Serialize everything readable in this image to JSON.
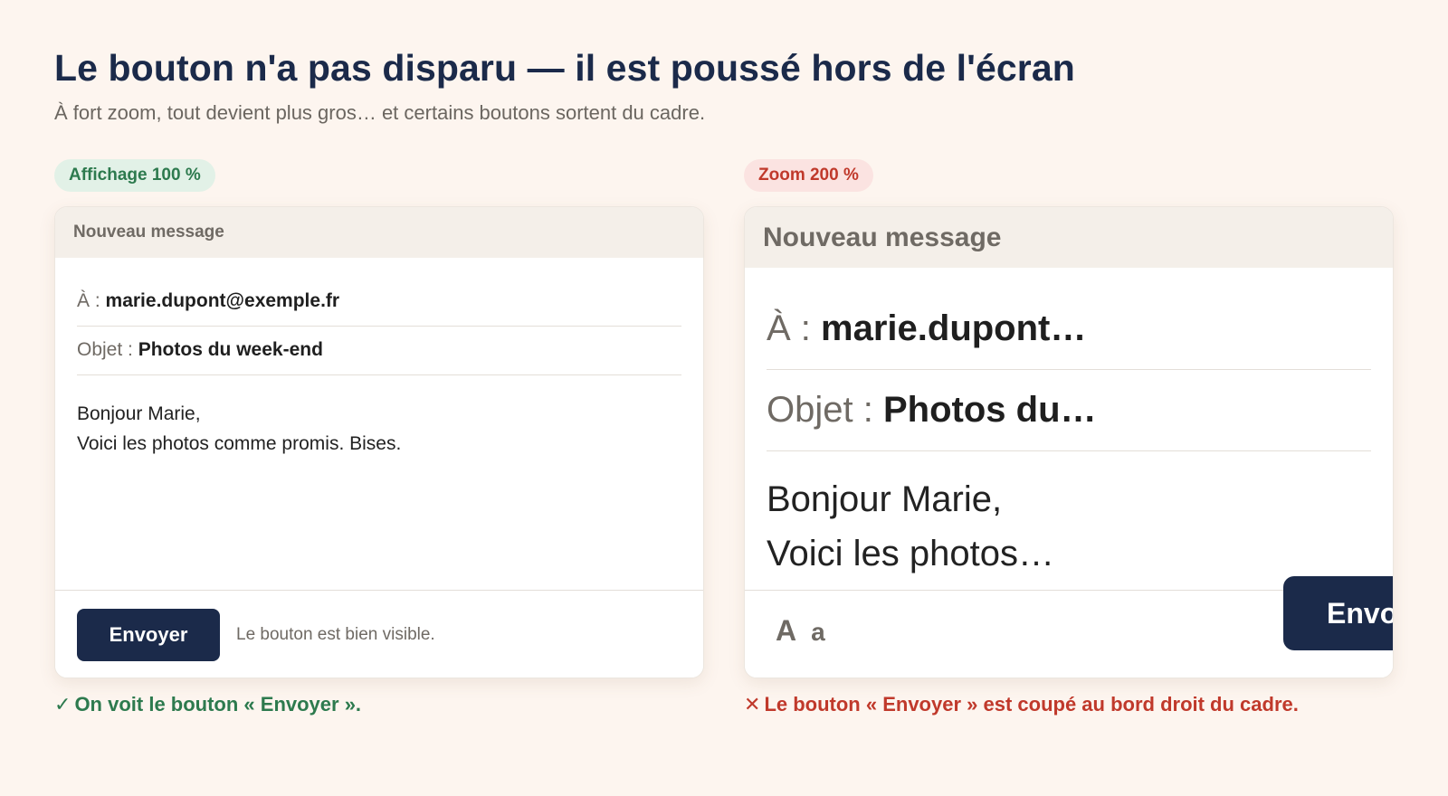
{
  "header": {
    "title": "Le bouton n'a pas disparu — il est poussé hors de l'écran",
    "subtitle": "À fort zoom, tout devient plus gros… et certains boutons sortent du cadre."
  },
  "left_panel": {
    "badge": "Affichage 100 %",
    "window_title": "Nouveau message",
    "to_label": "À :",
    "to_value": "marie.dupont@exemple.fr",
    "subject_label": "Objet :",
    "subject_value": "Photos du week-end",
    "body_line1": "Bonjour Marie,",
    "body_line2": "Voici les photos comme promis. Bises.",
    "send_button": "Envoyer",
    "footer_note": "Le bouton est bien visible.",
    "caption_icon": "check-icon",
    "caption_mark": "✓",
    "caption": "On voit le bouton « Envoyer ».",
    "accent_color": "#2d7a4e"
  },
  "right_panel": {
    "badge": "Zoom 200 %",
    "window_title": "Nouveau message",
    "to_label": "À :",
    "to_value": "marie.dupont…",
    "subject_label": "Objet :",
    "subject_value": "Photos du…",
    "body_line1": "Bonjour Marie,",
    "body_line2": "Voici les photos…",
    "send_button": "Envo",
    "font_big": "A",
    "font_small": "a",
    "caption_icon": "cross-icon",
    "caption_mark": "✕",
    "caption": "Le bouton « Envoyer » est coupé au bord droit du cadre.",
    "accent_color": "#c0392b"
  },
  "colors": {
    "background": "#fdf5ef",
    "button": "#1b2a4a"
  }
}
